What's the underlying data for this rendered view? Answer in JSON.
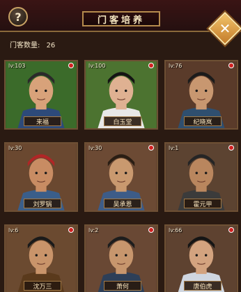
{
  "header": {
    "help_label": "?",
    "title": "门客培养",
    "close_label": "✕"
  },
  "count": {
    "label": "门客数量:",
    "value": "26"
  },
  "cards": [
    {
      "level": "lv:103",
      "name": "来福",
      "dot": true,
      "bg": "#3b6b2a",
      "skin": "#d8a27a",
      "hat": "#2a2a2a",
      "robe": "#2d4a7a"
    },
    {
      "level": "lv:100",
      "name": "白玉堂",
      "dot": true,
      "bg": "#4c7330",
      "skin": "#dfb192",
      "hat": "#141414",
      "robe": "#e8e8e8"
    },
    {
      "level": "lv:76",
      "name": "纪晓岚",
      "dot": true,
      "bg": "#5a3b2a",
      "skin": "#c89770",
      "hat": "#1b1b1b",
      "robe": "#2f4f6f"
    },
    {
      "level": "lv:30",
      "name": "刘罗锅",
      "dot": false,
      "bg": "#6a4830",
      "skin": "#c88c63",
      "hat": "#b02626",
      "robe": "#3a5e8a"
    },
    {
      "level": "lv:30",
      "name": "吴承恩",
      "dot": true,
      "bg": "#6c4a34",
      "skin": "#c9996f",
      "hat": "#2a1e14",
      "robe": "#3d5c88"
    },
    {
      "level": "lv:1",
      "name": "霍元甲",
      "dot": true,
      "bg": "#5c4331",
      "skin": "#b9865e",
      "hat": "#252525",
      "robe": "#3b3b3b"
    },
    {
      "level": "lv:6",
      "name": "沈万三",
      "dot": true,
      "bg": "#6b4a30",
      "skin": "#c9946a",
      "hat": "#1a1a1a",
      "robe": "#5a3a1c"
    },
    {
      "level": "lv:2",
      "name": "萧何",
      "dot": true,
      "bg": "#694834",
      "skin": "#c7966d",
      "hat": "#1d1d1d",
      "robe": "#2d3f58"
    },
    {
      "level": "lv:66",
      "name": "唐伯虎",
      "dot": true,
      "bg": "#5e4230",
      "skin": "#d3a37f",
      "hat": "#151515",
      "robe": "#cfd6e0"
    }
  ]
}
